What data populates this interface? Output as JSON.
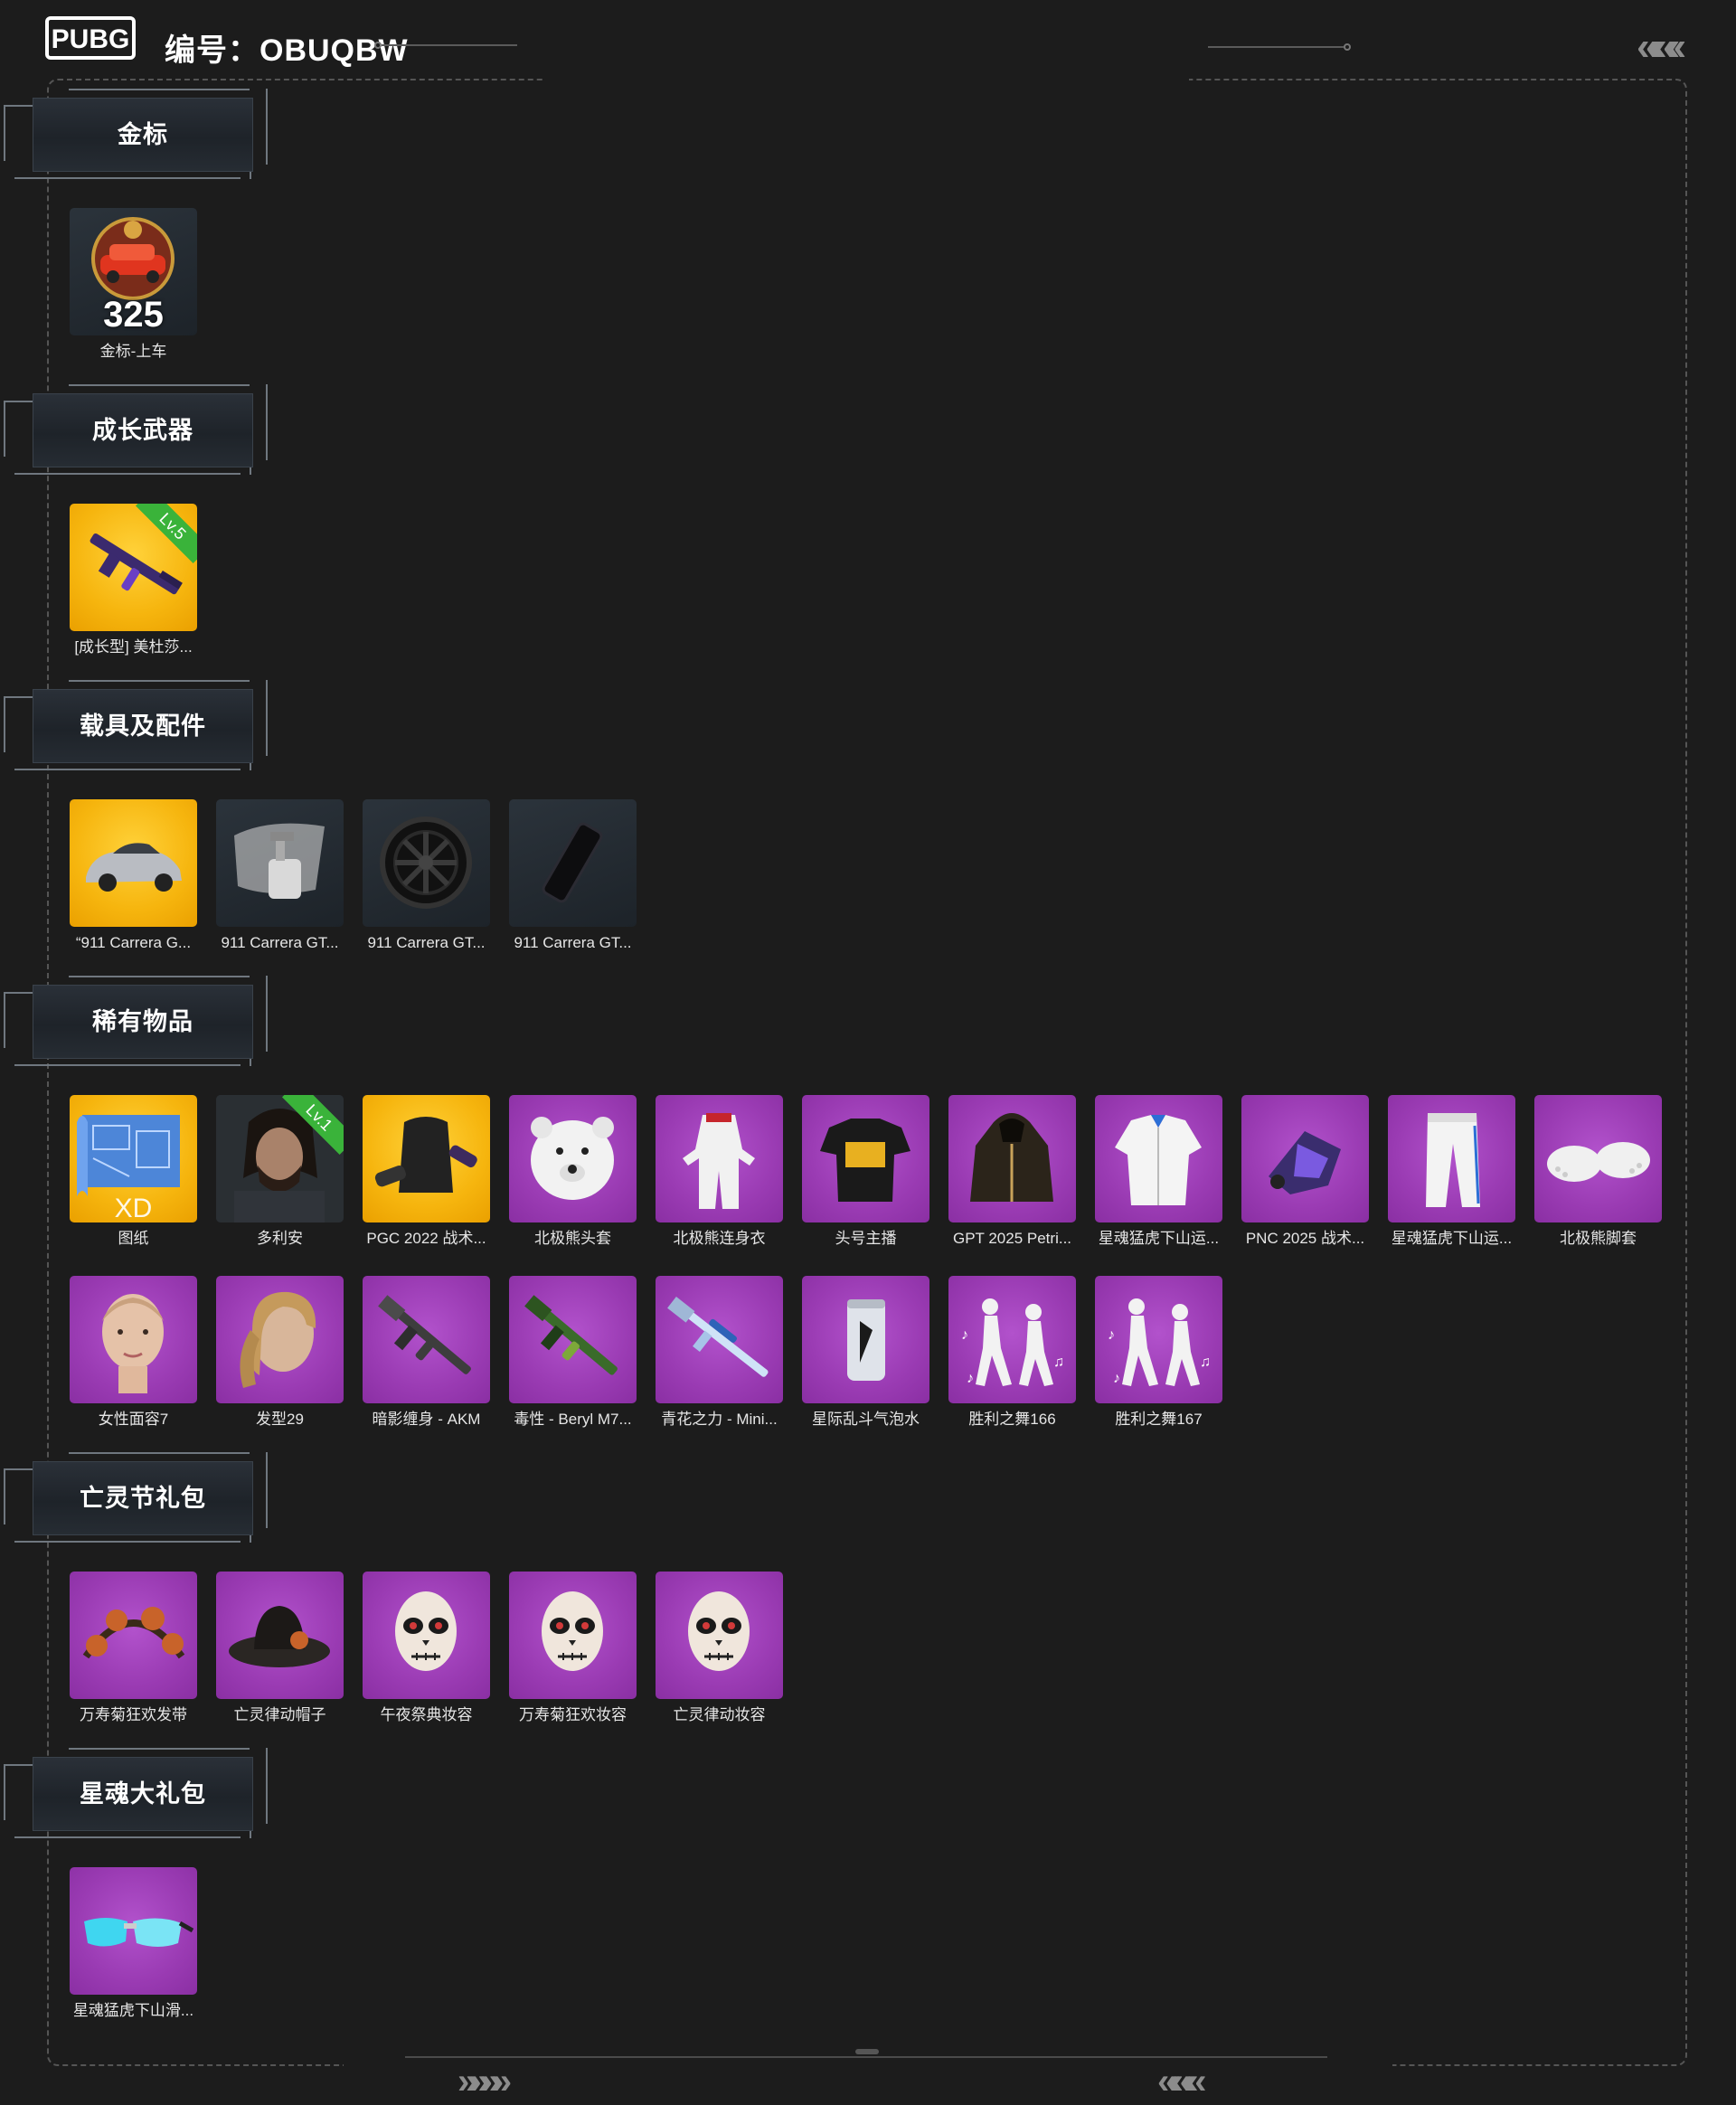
{
  "header": {
    "logo_text": "PUBG",
    "code_label": "编号：",
    "code_value": "OBUQBW"
  },
  "colors": {
    "background": "#1c1c1c",
    "tile_purple": "#9a3bb3",
    "tile_gold": "#f6b50e",
    "tile_dark": "#252c33",
    "level_badge": "#3ab33a"
  },
  "sections": [
    {
      "title": "金标",
      "rows": [
        [
          {
            "label": "金标-上车",
            "bg": "dark",
            "icon": "gold-medal-car-icon",
            "badge_number": "325"
          }
        ]
      ]
    },
    {
      "title": "成长武器",
      "rows": [
        [
          {
            "label": "[成长型] 美杜莎...",
            "bg": "gold",
            "icon": "rifle-icon",
            "level": "Lv.5"
          }
        ]
      ]
    },
    {
      "title": "载具及配件",
      "rows": [
        [
          {
            "label": "“911 Carrera G...",
            "bg": "gold",
            "icon": "car-icon"
          },
          {
            "label": "911 Carrera GT...",
            "bg": "dark",
            "icon": "spray-paint-icon"
          },
          {
            "label": "911 Carrera GT...",
            "bg": "dark",
            "icon": "wheel-icon"
          },
          {
            "label": "911 Carrera GT...",
            "bg": "dark",
            "icon": "license-plate-icon"
          }
        ]
      ]
    },
    {
      "title": "稀有物品",
      "rows": [
        [
          {
            "label": "图纸",
            "bg": "gold",
            "icon": "blueprint-icon",
            "overlay": "XD"
          },
          {
            "label": "多利安",
            "bg": "dark",
            "icon": "character-portrait-icon",
            "level": "Lv.1"
          },
          {
            "label": "PGC 2022 战术...",
            "bg": "gold",
            "icon": "backpack-icon"
          },
          {
            "label": "北极熊头套",
            "bg": "purple",
            "icon": "polar-bear-head-icon"
          },
          {
            "label": "北极熊连身衣",
            "bg": "purple",
            "icon": "jumpsuit-icon"
          },
          {
            "label": "头号主播",
            "bg": "purple",
            "icon": "tshirt-icon"
          },
          {
            "label": "GPT 2025 Petri...",
            "bg": "purple",
            "icon": "hoodie-icon"
          },
          {
            "label": "星魂猛虎下山运...",
            "bg": "purple",
            "icon": "jacket-icon"
          },
          {
            "label": "PNC 2025 战术...",
            "bg": "purple",
            "icon": "tactical-item-icon"
          },
          {
            "label": "星魂猛虎下山运...",
            "bg": "purple",
            "icon": "pants-icon"
          },
          {
            "label": "北极熊脚套",
            "bg": "purple",
            "icon": "paw-boots-icon"
          }
        ],
        [
          {
            "label": "女性面容7",
            "bg": "purple",
            "icon": "female-face-icon"
          },
          {
            "label": "发型29",
            "bg": "purple",
            "icon": "hairstyle-icon"
          },
          {
            "label": "暗影缠身 - AKM",
            "bg": "purple",
            "icon": "akm-rifle-icon"
          },
          {
            "label": "毒性 - Beryl M7...",
            "bg": "purple",
            "icon": "beryl-rifle-icon"
          },
          {
            "label": "青花之力 - Mini...",
            "bg": "purple",
            "icon": "sniper-rifle-icon"
          },
          {
            "label": "星际乱斗气泡水",
            "bg": "purple",
            "icon": "soda-can-icon"
          },
          {
            "label": "胜利之舞166",
            "bg": "purple",
            "icon": "dance-emote-icon"
          },
          {
            "label": "胜利之舞167",
            "bg": "purple",
            "icon": "dance-emote-icon"
          }
        ]
      ]
    },
    {
      "title": "亡灵节礼包",
      "rows": [
        [
          {
            "label": "万寿菊狂欢发带",
            "bg": "purple",
            "icon": "flower-headband-icon"
          },
          {
            "label": "亡灵律动帽子",
            "bg": "purple",
            "icon": "cowboy-hat-icon"
          },
          {
            "label": "午夜祭典妆容",
            "bg": "purple",
            "icon": "skull-makeup-icon"
          },
          {
            "label": "万寿菊狂欢妆容",
            "bg": "purple",
            "icon": "skull-makeup-icon"
          },
          {
            "label": "亡灵律动妆容",
            "bg": "purple",
            "icon": "skull-makeup-icon"
          }
        ]
      ]
    },
    {
      "title": "星魂大礼包",
      "rows": [
        [
          {
            "label": "星魂猛虎下山滑...",
            "bg": "purple",
            "icon": "sunglasses-icon"
          }
        ]
      ]
    }
  ]
}
